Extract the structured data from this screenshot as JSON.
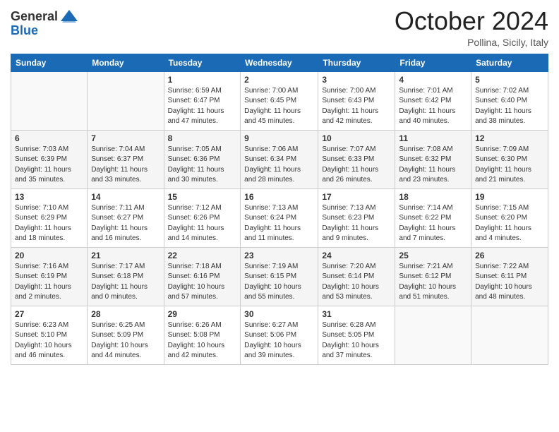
{
  "header": {
    "logo_general": "General",
    "logo_blue": "Blue",
    "title": "October 2024",
    "location": "Pollina, Sicily, Italy"
  },
  "days_of_week": [
    "Sunday",
    "Monday",
    "Tuesday",
    "Wednesday",
    "Thursday",
    "Friday",
    "Saturday"
  ],
  "weeks": [
    [
      {
        "day": "",
        "info": ""
      },
      {
        "day": "",
        "info": ""
      },
      {
        "day": "1",
        "info": "Sunrise: 6:59 AM\nSunset: 6:47 PM\nDaylight: 11 hours and 47 minutes."
      },
      {
        "day": "2",
        "info": "Sunrise: 7:00 AM\nSunset: 6:45 PM\nDaylight: 11 hours and 45 minutes."
      },
      {
        "day": "3",
        "info": "Sunrise: 7:00 AM\nSunset: 6:43 PM\nDaylight: 11 hours and 42 minutes."
      },
      {
        "day": "4",
        "info": "Sunrise: 7:01 AM\nSunset: 6:42 PM\nDaylight: 11 hours and 40 minutes."
      },
      {
        "day": "5",
        "info": "Sunrise: 7:02 AM\nSunset: 6:40 PM\nDaylight: 11 hours and 38 minutes."
      }
    ],
    [
      {
        "day": "6",
        "info": "Sunrise: 7:03 AM\nSunset: 6:39 PM\nDaylight: 11 hours and 35 minutes."
      },
      {
        "day": "7",
        "info": "Sunrise: 7:04 AM\nSunset: 6:37 PM\nDaylight: 11 hours and 33 minutes."
      },
      {
        "day": "8",
        "info": "Sunrise: 7:05 AM\nSunset: 6:36 PM\nDaylight: 11 hours and 30 minutes."
      },
      {
        "day": "9",
        "info": "Sunrise: 7:06 AM\nSunset: 6:34 PM\nDaylight: 11 hours and 28 minutes."
      },
      {
        "day": "10",
        "info": "Sunrise: 7:07 AM\nSunset: 6:33 PM\nDaylight: 11 hours and 26 minutes."
      },
      {
        "day": "11",
        "info": "Sunrise: 7:08 AM\nSunset: 6:32 PM\nDaylight: 11 hours and 23 minutes."
      },
      {
        "day": "12",
        "info": "Sunrise: 7:09 AM\nSunset: 6:30 PM\nDaylight: 11 hours and 21 minutes."
      }
    ],
    [
      {
        "day": "13",
        "info": "Sunrise: 7:10 AM\nSunset: 6:29 PM\nDaylight: 11 hours and 18 minutes."
      },
      {
        "day": "14",
        "info": "Sunrise: 7:11 AM\nSunset: 6:27 PM\nDaylight: 11 hours and 16 minutes."
      },
      {
        "day": "15",
        "info": "Sunrise: 7:12 AM\nSunset: 6:26 PM\nDaylight: 11 hours and 14 minutes."
      },
      {
        "day": "16",
        "info": "Sunrise: 7:13 AM\nSunset: 6:24 PM\nDaylight: 11 hours and 11 minutes."
      },
      {
        "day": "17",
        "info": "Sunrise: 7:13 AM\nSunset: 6:23 PM\nDaylight: 11 hours and 9 minutes."
      },
      {
        "day": "18",
        "info": "Sunrise: 7:14 AM\nSunset: 6:22 PM\nDaylight: 11 hours and 7 minutes."
      },
      {
        "day": "19",
        "info": "Sunrise: 7:15 AM\nSunset: 6:20 PM\nDaylight: 11 hours and 4 minutes."
      }
    ],
    [
      {
        "day": "20",
        "info": "Sunrise: 7:16 AM\nSunset: 6:19 PM\nDaylight: 11 hours and 2 minutes."
      },
      {
        "day": "21",
        "info": "Sunrise: 7:17 AM\nSunset: 6:18 PM\nDaylight: 11 hours and 0 minutes."
      },
      {
        "day": "22",
        "info": "Sunrise: 7:18 AM\nSunset: 6:16 PM\nDaylight: 10 hours and 57 minutes."
      },
      {
        "day": "23",
        "info": "Sunrise: 7:19 AM\nSunset: 6:15 PM\nDaylight: 10 hours and 55 minutes."
      },
      {
        "day": "24",
        "info": "Sunrise: 7:20 AM\nSunset: 6:14 PM\nDaylight: 10 hours and 53 minutes."
      },
      {
        "day": "25",
        "info": "Sunrise: 7:21 AM\nSunset: 6:12 PM\nDaylight: 10 hours and 51 minutes."
      },
      {
        "day": "26",
        "info": "Sunrise: 7:22 AM\nSunset: 6:11 PM\nDaylight: 10 hours and 48 minutes."
      }
    ],
    [
      {
        "day": "27",
        "info": "Sunrise: 6:23 AM\nSunset: 5:10 PM\nDaylight: 10 hours and 46 minutes."
      },
      {
        "day": "28",
        "info": "Sunrise: 6:25 AM\nSunset: 5:09 PM\nDaylight: 10 hours and 44 minutes."
      },
      {
        "day": "29",
        "info": "Sunrise: 6:26 AM\nSunset: 5:08 PM\nDaylight: 10 hours and 42 minutes."
      },
      {
        "day": "30",
        "info": "Sunrise: 6:27 AM\nSunset: 5:06 PM\nDaylight: 10 hours and 39 minutes."
      },
      {
        "day": "31",
        "info": "Sunrise: 6:28 AM\nSunset: 5:05 PM\nDaylight: 10 hours and 37 minutes."
      },
      {
        "day": "",
        "info": ""
      },
      {
        "day": "",
        "info": ""
      }
    ]
  ]
}
